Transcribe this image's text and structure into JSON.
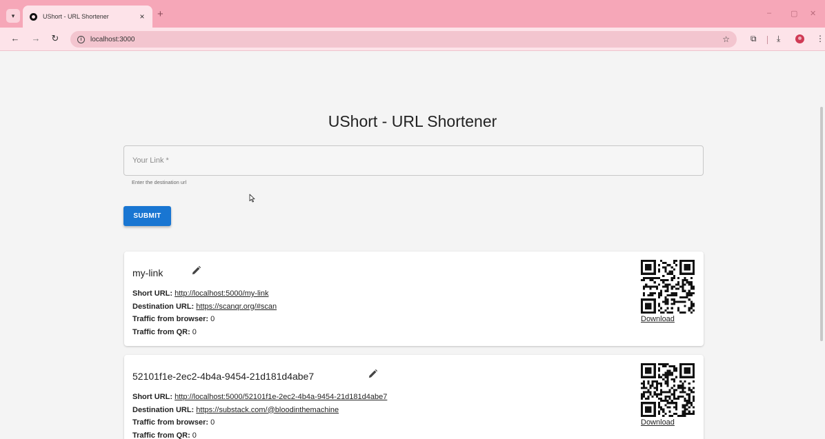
{
  "browser": {
    "tab_title": "UShort - URL Shortener",
    "tab_close": "×",
    "new_tab": "+",
    "url": "localhost:3000",
    "window_controls": {
      "minimize": "–",
      "restore": "▢",
      "close": "✕"
    }
  },
  "app": {
    "title": "UShort - URL Shortener",
    "link_field": {
      "placeholder": "Your Link *",
      "value": ""
    },
    "helper_text": "Enter the destination url",
    "submit_label": "SUBMIT"
  },
  "links": [
    {
      "slug": "my-link",
      "short_url_label": "Short URL:",
      "short_url": "http://localhost:5000/my-link",
      "destination_label": "Destination URL:",
      "destination_url": "https://scanqr.org/#scan",
      "browser_traffic_label": "Traffic from browser:",
      "browser_traffic": "0",
      "qr_traffic_label": "Traffic from QR:",
      "qr_traffic": "0",
      "download_label": "Download"
    },
    {
      "slug": "52101f1e-2ec2-4b4a-9454-21d181d4abe7",
      "short_url_label": "Short URL:",
      "short_url": "http://localhost:5000/52101f1e-2ec2-4b4a-9454-21d181d4abe7",
      "destination_label": "Destination URL:",
      "destination_url": "https://substack.com/@bloodinthemachine",
      "browser_traffic_label": "Traffic from browser:",
      "browser_traffic": "0",
      "qr_traffic_label": "Traffic from QR:",
      "qr_traffic": "0",
      "download_label": "Download"
    }
  ],
  "icons": {
    "tab_search": "chevron-down-icon",
    "back": "arrow-left-icon",
    "forward": "arrow-right-icon",
    "reload": "reload-icon",
    "site_info": "info-icon",
    "bookmark": "star-icon",
    "extensions": "puzzle-icon",
    "downloads": "download-icon",
    "profile": "profile-icon",
    "menu": "kebab-menu-icon",
    "edit": "pencil-icon",
    "qr": "qr-code-icon"
  },
  "colors": {
    "tabbar": "#f6a7b8",
    "toolbar": "#fde3e9",
    "primary_button": "#1976d2",
    "page_background": "#f4f4f4",
    "profile_avatar": "#d03a55"
  }
}
